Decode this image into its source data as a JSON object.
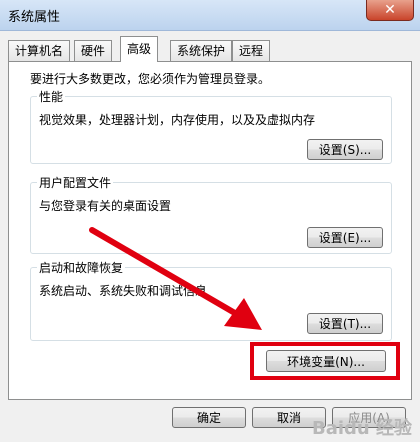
{
  "window": {
    "title": "系统属性",
    "close_label": "✕"
  },
  "tabs": [
    {
      "label": "计算机名"
    },
    {
      "label": "硬件"
    },
    {
      "label": "高级"
    },
    {
      "label": "系统保护"
    },
    {
      "label": "远程"
    }
  ],
  "intro_text": "要进行大多数更改，您必须作为管理员登录。",
  "performance": {
    "title": "性能",
    "description": "视觉效果，处理器计划，内存使用，以及及虚拟内存",
    "button": "设置(S)..."
  },
  "user_profiles": {
    "title": "用户配置文件",
    "description": "与您登录有关的桌面设置",
    "button": "设置(E)..."
  },
  "startup_recovery": {
    "title": "启动和故障恢复",
    "description": "系统启动、系统失败和调试信息",
    "button": "设置(T)..."
  },
  "env_vars_button": "环境变量(N)...",
  "footer": {
    "ok": "确定",
    "cancel": "取消",
    "apply": "应用(A)"
  },
  "watermark": "Baidu 经验",
  "colors": {
    "highlight": "#e00010",
    "arrow": "#e00010"
  }
}
